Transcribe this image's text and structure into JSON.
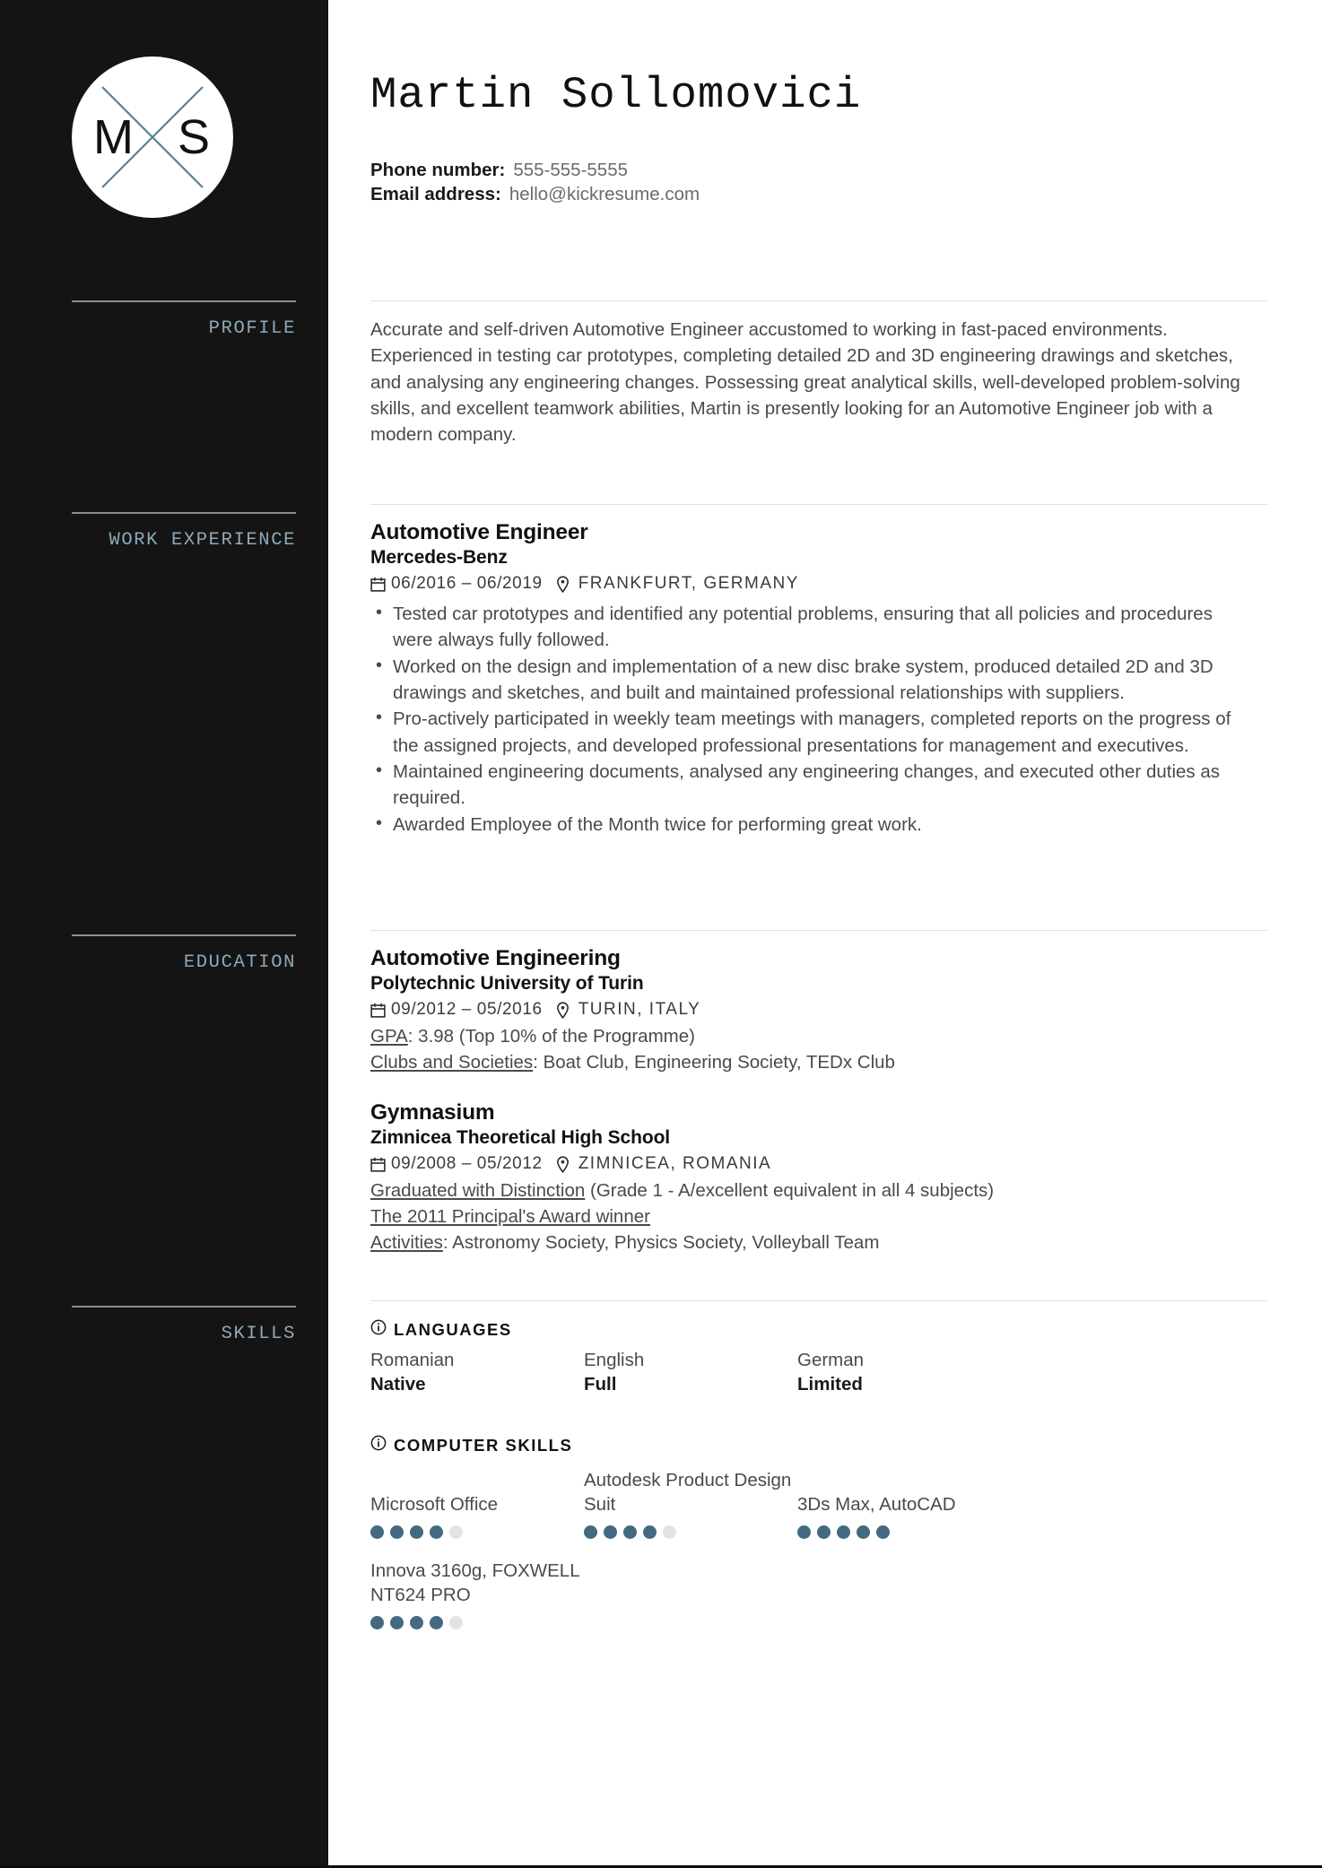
{
  "colors": {
    "sidebar_bg": "#141414",
    "sidebar_label": "#8fa9bb",
    "accent_dot": "#436a80",
    "body_text": "#4a4a4a",
    "heading": "#111111"
  },
  "sidebar": {
    "monogram": {
      "left_letter": "M",
      "right_letter": "S",
      "icon": "monogram-x-circle"
    },
    "sections": [
      {
        "id": "profile",
        "label": "PROFILE"
      },
      {
        "id": "work-experience",
        "label": "WORK EXPERIENCE"
      },
      {
        "id": "education",
        "label": "EDUCATION"
      },
      {
        "id": "skills",
        "label": "SKILLS"
      }
    ]
  },
  "header": {
    "name": "Martin Sollomovici",
    "contact": [
      {
        "key": "Phone number:",
        "value": "555-555-5555"
      },
      {
        "key": "Email address:",
        "value": "hello@kickresume.com"
      }
    ]
  },
  "profile": {
    "text": "Accurate and self-driven Automotive Engineer accustomed to working in fast-paced environments. Experienced in testing car prototypes, completing detailed 2D and 3D engineering drawings and sketches, and analysing any engineering changes. Possessing great analytical skills, well-developed problem-solving skills, and excellent teamwork abilities, Martin is presently looking for an Automotive Engineer job with a modern company."
  },
  "work_experience": [
    {
      "title": "Automotive Engineer",
      "company": "Mercedes-Benz",
      "date": "06/2016 – 06/2019",
      "location": "FRANKFURT, GERMANY",
      "bullets": [
        "Tested car prototypes and identified any potential problems, ensuring that all policies and procedures were always fully followed.",
        "Worked on the design and implementation of a new disc brake system, produced detailed 2D and 3D drawings and sketches, and built and maintained professional relationships with suppliers.",
        "Pro-actively participated in weekly team meetings with managers, completed reports on the progress of the assigned projects, and developed professional presentations for management and executives.",
        "Maintained engineering documents, analysed any engineering changes, and executed other duties as required.",
        "Awarded Employee of the Month twice for performing great work."
      ]
    }
  ],
  "education": [
    {
      "title": "Automotive Engineering",
      "school": "Polytechnic University of Turin",
      "date": "09/2012 – 05/2016",
      "location": "TURIN, ITALY",
      "details": [
        {
          "underlined": "GPA",
          "rest": ": 3.98 (Top 10% of the Programme)"
        },
        {
          "underlined": "Clubs and Societies",
          "rest": ": Boat Club, Engineering Society, TEDx Club"
        }
      ]
    },
    {
      "title": "Gymnasium",
      "school": "Zimnicea Theoretical High School",
      "date": "09/2008 – 05/2012",
      "location": "ZIMNICEA, ROMANIA",
      "details": [
        {
          "underlined": "Graduated with Distinction",
          "rest": " (Grade 1 - A/excellent equivalent in all 4 subjects)"
        },
        {
          "underlined": "The 2011 Principal's Award winner",
          "rest": ""
        },
        {
          "underlined": "Activities",
          "rest": ": Astronomy Society, Physics Society, Volleyball Team"
        }
      ]
    }
  ],
  "skills": {
    "languages": {
      "heading": "LANGUAGES",
      "icon": "info-icon",
      "items": [
        {
          "name": "Romanian",
          "level": "Native"
        },
        {
          "name": "English",
          "level": "Full"
        },
        {
          "name": "German",
          "level": "Limited"
        }
      ]
    },
    "computer": {
      "heading": "COMPUTER SKILLS",
      "icon": "info-icon",
      "max_rating": 5,
      "items": [
        {
          "name": "Microsoft Office",
          "rating": 4
        },
        {
          "name": "Autodesk Product Design Suit",
          "rating": 4
        },
        {
          "name": "3Ds Max, AutoCAD",
          "rating": 5
        },
        {
          "name": "Innova 3160g, FOXWELL NT624 PRO",
          "rating": 4
        }
      ]
    }
  }
}
